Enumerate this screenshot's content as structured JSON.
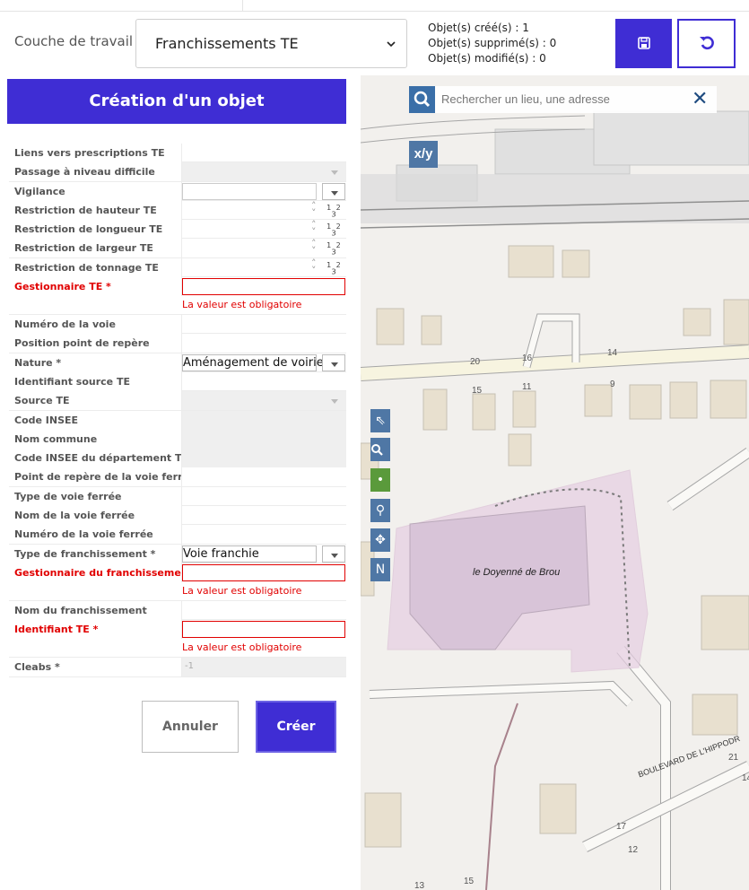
{
  "topbar": {
    "layer_label": "Couche de travail",
    "layer_value": "Franchissements TE",
    "counter_created": "Objet(s) créé(s) : 1",
    "counter_deleted": "Objet(s) supprimé(s) : 0",
    "counter_modified": "Objet(s) modifié(s) : 0",
    "save_icon": "floppy-disk-icon",
    "undo_icon": "undo-icon"
  },
  "form": {
    "title": "Création d'un objet",
    "required_message": "La valeur est obligatoire",
    "fields": [
      {
        "label": "Liens vers prescriptions TE",
        "value": "",
        "type": "text"
      },
      {
        "label": "Passage à niveau difficile",
        "value": "",
        "type": "select-disabled"
      },
      {
        "label": "Vigilance",
        "value": "",
        "type": "select"
      },
      {
        "label": "Restriction de hauteur TE",
        "value": "",
        "type": "number"
      },
      {
        "label": "Restriction de longueur TE",
        "value": "",
        "type": "number"
      },
      {
        "label": "Restriction de largeur TE",
        "value": "",
        "type": "number"
      },
      {
        "label": "Restriction de tonnage TE",
        "value": "",
        "type": "number"
      },
      {
        "label": "Gestionnaire TE *",
        "value": "",
        "type": "text-required"
      },
      {
        "label": "Numéro de la voie",
        "value": "",
        "type": "text"
      },
      {
        "label": "Position point de repère",
        "value": "",
        "type": "text"
      },
      {
        "label": "Nature *",
        "value": "Aménagement de voirie",
        "type": "select"
      },
      {
        "label": "Identifiant source TE",
        "value": "",
        "type": "text"
      },
      {
        "label": "Source TE",
        "value": "",
        "type": "select-disabled"
      },
      {
        "label": "Code INSEE",
        "value": "",
        "type": "disabled"
      },
      {
        "label": "Nom commune",
        "value": "",
        "type": "disabled"
      },
      {
        "label": "Code INSEE du département TE",
        "value": "",
        "type": "disabled"
      },
      {
        "label": "Point de repère de la voie ferrée",
        "value": "",
        "type": "text"
      },
      {
        "label": "Type de voie ferrée",
        "value": "",
        "type": "text"
      },
      {
        "label": "Nom de la voie ferrée",
        "value": "",
        "type": "text"
      },
      {
        "label": "Numéro de la voie ferrée",
        "value": "",
        "type": "text"
      },
      {
        "label": "Type de franchissement *",
        "value": "Voie franchie",
        "type": "select"
      },
      {
        "label": "Gestionnaire du franchissement *",
        "value": "",
        "type": "text-required"
      },
      {
        "label": "Nom du franchissement",
        "value": "",
        "type": "text"
      },
      {
        "label": "Identifiant TE *",
        "value": "",
        "type": "text-required"
      },
      {
        "label": "Cleabs *",
        "value": "-1",
        "type": "readonly"
      }
    ],
    "number_spinner": "⌃⌄",
    "number_format_icon": "1/3",
    "cancel_label": "Annuler",
    "create_label": "Créer"
  },
  "map": {
    "search_placeholder": "Rechercher un lieu, une adresse",
    "search_icon": "search-icon",
    "close_icon": "close-icon",
    "xy_label": "x/y",
    "tools": [
      "select-arrow-icon",
      "zoom-icon",
      "point-icon",
      "marker-icon",
      "move-icon",
      "north-icon"
    ],
    "north_label": "N",
    "poi": "le Doyenné de Brou",
    "street": "BOULEVARD DE L'HIPPODR",
    "numbers": [
      "20",
      "16",
      "14",
      "15",
      "11",
      "9",
      "21",
      "17",
      "14",
      "12",
      "15",
      "13"
    ]
  },
  "colors": {
    "accent": "#3f2dd4",
    "required": "#e10000",
    "map_control": "#4f77a5"
  }
}
